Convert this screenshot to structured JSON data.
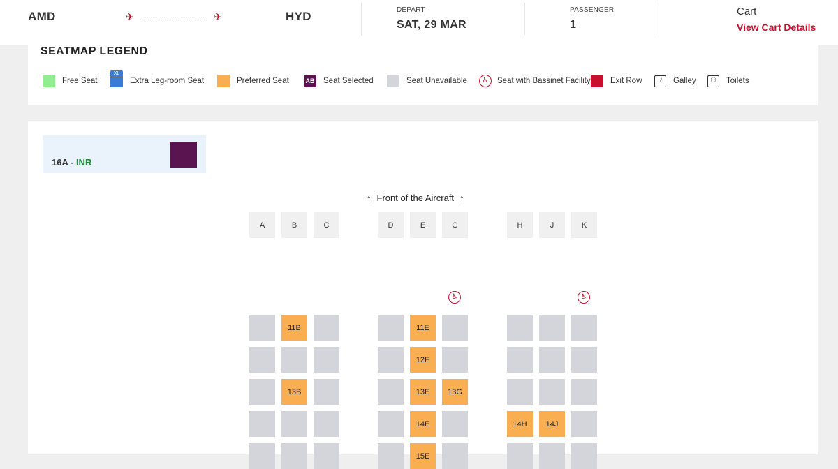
{
  "header": {
    "origin": "AMD",
    "destination": "HYD",
    "depart_label": "DEPART",
    "depart_value": "SAT, 29 MAR",
    "passenger_label": "PASSENGER",
    "passenger_value": "1",
    "cart_label": "Cart",
    "cart_link": "View Cart Details",
    "departure_icon": "plane-takeoff-icon",
    "arrival_icon": "plane-landing-icon"
  },
  "legend": {
    "title": "SEATMAP LEGEND",
    "items": [
      {
        "label": "Free Seat",
        "icon": "free-seat-swatch",
        "color": "#90ee90"
      },
      {
        "label": "Extra Leg-room Seat",
        "icon": "xl-seat-icon",
        "color": "#3a7bd5"
      },
      {
        "label": "Preferred Seat",
        "icon": "preferred-seat-swatch",
        "color": "#f9ae52"
      },
      {
        "label": "Seat Selected",
        "icon": "selected-seat-swatch",
        "color": "#5a1450",
        "badge": "AB"
      },
      {
        "label": "Seat Unavailable",
        "icon": "unavailable-seat-swatch",
        "color": "#d3d5da"
      },
      {
        "label": "Seat with Bassinet Facility",
        "icon": "bassinet-icon",
        "color": "#c8102e"
      },
      {
        "label": "Exit Row",
        "icon": "exit-row-swatch",
        "color": "#c8102e"
      },
      {
        "label": "Galley",
        "icon": "galley-icon"
      },
      {
        "label": "Toilets",
        "icon": "toilet-icon"
      }
    ]
  },
  "selected": {
    "seat": "16A -",
    "currency": "INR",
    "color": "#5a1450"
  },
  "seatmap": {
    "front_label": "Front of the Aircraft",
    "columns": [
      "A",
      "B",
      "C",
      "D",
      "E",
      "G",
      "H",
      "J",
      "K"
    ],
    "bassinet_columns": [
      "G",
      "K"
    ],
    "rows": [
      {
        "row": "11",
        "seats": [
          "",
          "11B",
          "",
          "",
          "11E",
          "",
          "",
          "",
          ""
        ]
      },
      {
        "row": "12",
        "seats": [
          "",
          "",
          "",
          "",
          "12E",
          "",
          "",
          "",
          ""
        ]
      },
      {
        "row": "13",
        "seats": [
          "",
          "13B",
          "",
          "",
          "13E",
          "13G",
          "",
          "",
          ""
        ]
      },
      {
        "row": "14",
        "seats": [
          "",
          "",
          "",
          "",
          "14E",
          "",
          "14H",
          "14J",
          ""
        ]
      },
      {
        "row": "15",
        "seats": [
          "",
          "",
          "",
          "",
          "15E",
          "",
          "",
          "",
          ""
        ]
      }
    ],
    "colors": {
      "unavailable": "#d3d5da",
      "preferred": "#f9ae52"
    }
  }
}
